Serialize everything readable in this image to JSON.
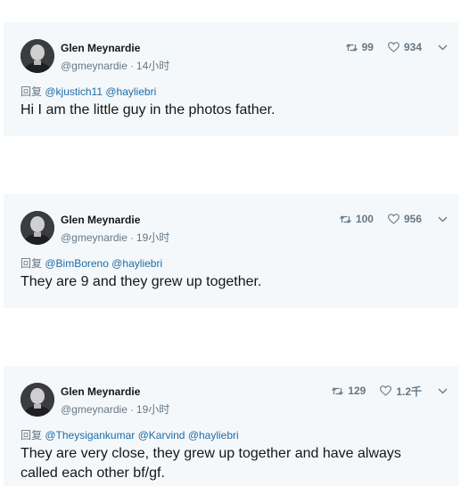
{
  "tweets": [
    {
      "name": "Glen Meynardie",
      "handle": "@gmeynardie",
      "separator": "·",
      "time": "14小时",
      "retweets": "99",
      "likes": "934",
      "reply_prefix": "回复",
      "mentions": [
        "@kjustich11",
        "@hayliebri"
      ],
      "text": "Hi I am the little guy in the photos father."
    },
    {
      "name": "Glen Meynardie",
      "handle": "@gmeynardie",
      "separator": "·",
      "time": "19小时",
      "retweets": "100",
      "likes": "956",
      "reply_prefix": "回复",
      "mentions": [
        "@BimBoreno",
        "@hayliebri"
      ],
      "text": "They are 9 and they grew up together."
    },
    {
      "name": "Glen Meynardie",
      "handle": "@gmeynardie",
      "separator": "·",
      "time": "19小时",
      "retweets": "129",
      "likes": "1.2千",
      "reply_prefix": "回复",
      "mentions": [
        "@Theysigankumar",
        "@Karvind",
        "@hayliebri"
      ],
      "text": "They are very close, they grew up together and have always called each other bf/gf."
    }
  ],
  "icons": {
    "retweet": "retweet-icon",
    "like": "heart-icon",
    "menu": "chevron-down-icon"
  },
  "colors": {
    "card_background": "#f5f8fa",
    "meta_text": "#657786",
    "mention": "#1b6ca8",
    "primary_text": "#14171a"
  }
}
